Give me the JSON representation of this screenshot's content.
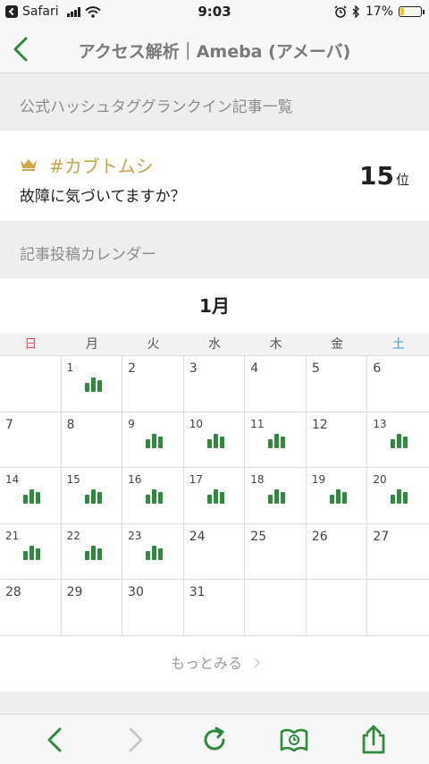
{
  "status_bar": {
    "carrier": "Safari",
    "time": "9:03",
    "battery_percent": "17%",
    "battery_level": 0.17
  },
  "nav": {
    "title": "アクセス解析｜Ameba (アメーバ)"
  },
  "ranking": {
    "section_title": "公式ハッシュタググランクイン記事一覧",
    "hashtag": "#カブトムシ",
    "article_title": "故障に気づいてますか？",
    "rank": "15",
    "rank_suffix": "位"
  },
  "calendar": {
    "section_title": "記事投稿カレンダー",
    "month": "1月",
    "weekdays": [
      "日",
      "月",
      "火",
      "水",
      "木",
      "金",
      "土"
    ],
    "weekday_colors": {
      "sun": "#e0506a",
      "sat": "#3aa0e0"
    },
    "posted_days": [
      "1",
      "9",
      "10",
      "11",
      "13",
      "14",
      "15",
      "16",
      "17",
      "18",
      "19",
      "20",
      "21",
      "22",
      "23"
    ],
    "cells": [
      "",
      "1",
      "2",
      "3",
      "4",
      "5",
      "6",
      "7",
      "8",
      "9",
      "10",
      "11",
      "12",
      "13",
      "14",
      "15",
      "16",
      "17",
      "18",
      "19",
      "20",
      "21",
      "22",
      "23",
      "24",
      "25",
      "26",
      "27",
      "28",
      "29",
      "30",
      "31",
      "",
      "",
      ""
    ],
    "bar_color": "#2e8b3d"
  },
  "more": {
    "label": "もっとみる"
  },
  "toolbar": {
    "icons": [
      "back-icon",
      "forward-icon",
      "reload-icon",
      "bookmarks-icon",
      "share-icon"
    ],
    "accent": "#2e8b3d"
  }
}
